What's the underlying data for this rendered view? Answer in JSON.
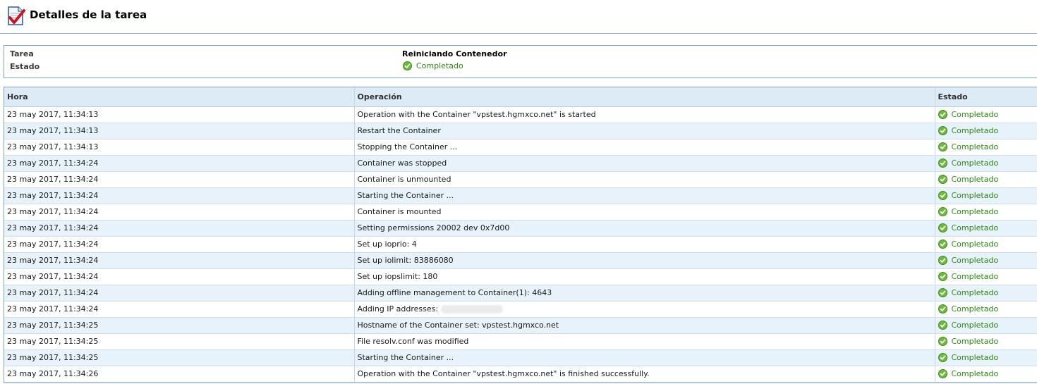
{
  "header": {
    "title": "Detalles de la tarea"
  },
  "summary": {
    "task_label": "Tarea",
    "task_value": "Reiniciando Contenedor",
    "status_label": "Estado",
    "status_value": "Completado"
  },
  "table": {
    "columns": [
      "Hora",
      "Operación",
      "Estado"
    ],
    "rows": [
      {
        "time": "23 may 2017, 11:34:13",
        "operation": "Operation with the Container \"vpstest.hgmxco.net\" is started",
        "status": "Completado"
      },
      {
        "time": "23 may 2017, 11:34:13",
        "operation": "Restart the Container",
        "status": "Completado"
      },
      {
        "time": "23 may 2017, 11:34:13",
        "operation": "Stopping the Container ...",
        "status": "Completado"
      },
      {
        "time": "23 may 2017, 11:34:24",
        "operation": "Container was stopped",
        "status": "Completado"
      },
      {
        "time": "23 may 2017, 11:34:24",
        "operation": "Container is unmounted",
        "status": "Completado"
      },
      {
        "time": "23 may 2017, 11:34:24",
        "operation": "Starting the Container ...",
        "status": "Completado"
      },
      {
        "time": "23 may 2017, 11:34:24",
        "operation": "Container is mounted",
        "status": "Completado"
      },
      {
        "time": "23 may 2017, 11:34:24",
        "operation": "Setting permissions 20002 dev 0x7d00",
        "status": "Completado"
      },
      {
        "time": "23 may 2017, 11:34:24",
        "operation": "Set up ioprio: 4",
        "status": "Completado"
      },
      {
        "time": "23 may 2017, 11:34:24",
        "operation": "Set up iolimit: 83886080",
        "status": "Completado"
      },
      {
        "time": "23 may 2017, 11:34:24",
        "operation": "Set up iopslimit: 180",
        "status": "Completado"
      },
      {
        "time": "23 may 2017, 11:34:24",
        "operation": "Adding offline management to Container(1): 4643",
        "status": "Completado"
      },
      {
        "time": "23 may 2017, 11:34:24",
        "operation": "Adding IP addresses:",
        "status": "Completado",
        "redacted": true
      },
      {
        "time": "23 may 2017, 11:34:25",
        "operation": "Hostname of the Container set: vpstest.hgmxco.net",
        "status": "Completado"
      },
      {
        "time": "23 may 2017, 11:34:25",
        "operation": "File resolv.conf was modified",
        "status": "Completado"
      },
      {
        "time": "23 may 2017, 11:34:25",
        "operation": "Starting the Container ...",
        "status": "Completado"
      },
      {
        "time": "23 may 2017, 11:34:26",
        "operation": "Operation with the Container \"vpstest.hgmxco.net\" is finished successfully.",
        "status": "Completado"
      }
    ]
  },
  "colors": {
    "success": "#2d8a12",
    "header_bg": "#dcebf6",
    "row_alt": "#e8f2fa",
    "border": "#7fa6c8"
  },
  "icons": {
    "header": "task-clipboard-check-icon",
    "status": "check-circle-icon"
  }
}
